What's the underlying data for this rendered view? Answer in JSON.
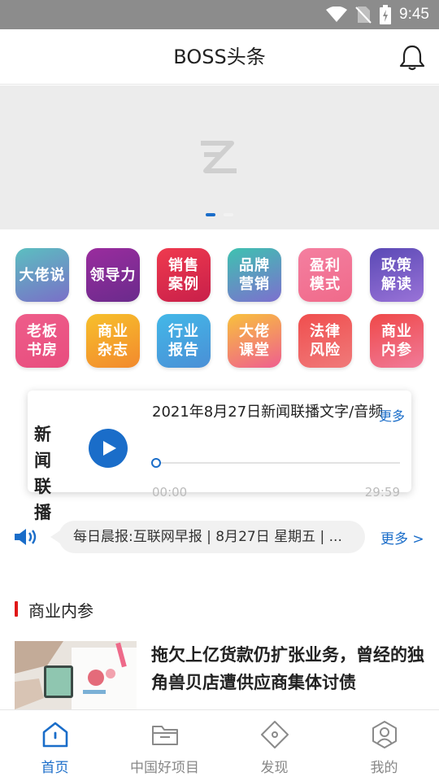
{
  "status": {
    "time": "9:45"
  },
  "header": {
    "title": "BOSS头条"
  },
  "banner": {
    "pages": 2,
    "active_page": 1
  },
  "categories": [
    {
      "label": "大佬说",
      "icon": "dalaoshuo",
      "colors": [
        "#5bbfc0",
        "#7a6fc8"
      ]
    },
    {
      "label": "领导力",
      "icon": "lingdaoli",
      "colors": [
        "#9a2c9e",
        "#6a2b8c"
      ]
    },
    {
      "label": "销售\n案例",
      "icon": "xiaoshou",
      "colors": [
        "#ef3a4e",
        "#c81f4a"
      ]
    },
    {
      "label": "品牌\n营销",
      "icon": "pinpai",
      "colors": [
        "#3ec2b0",
        "#7d6fcf"
      ]
    },
    {
      "label": "盈利\n模式",
      "icon": "yingli",
      "colors": [
        "#f47fa0",
        "#f06a8a"
      ]
    },
    {
      "label": "政策\n解读",
      "icon": "zhengce",
      "colors": [
        "#5a49b5",
        "#9a73d8"
      ]
    },
    {
      "label": "老板\n书房",
      "icon": "laoban",
      "colors": [
        "#ee5d8a",
        "#e84d7e"
      ]
    },
    {
      "label": "商业\n杂志",
      "icon": "zazhi",
      "colors": [
        "#f7c02c",
        "#f2892d"
      ]
    },
    {
      "label": "行业\n报告",
      "icon": "baogao",
      "colors": [
        "#43b8e8",
        "#4a8fd6"
      ]
    },
    {
      "label": "大佬\n课堂",
      "icon": "ketang",
      "colors": [
        "#f8c13c",
        "#ef5e8f"
      ]
    },
    {
      "label": "法律\n风险",
      "icon": "falv",
      "colors": [
        "#f04e4e",
        "#f07a7a"
      ]
    },
    {
      "label": "商业\n内参",
      "icon": "neican",
      "colors": [
        "#ef4848",
        "#f17b9a"
      ]
    }
  ],
  "news_player": {
    "label": "新 闻\n联 播",
    "title": "2021年8月27日新闻联播文字/音频",
    "more": "更多",
    "current_time": "00:00",
    "duration": "29:59",
    "progress": 0.0,
    "accent_color": "#1a6dc9"
  },
  "ticker": {
    "text": "每日晨报:互联网早报 | 8月27日 星期五 | ...",
    "more": "更多 >",
    "icon": "speaker-icon"
  },
  "section": {
    "title": "商业内参",
    "accent_color": "#e01818"
  },
  "article": {
    "title": "拖欠上亿货款仍扩张业务，曾经的独角兽贝店遭供应商集体讨债"
  },
  "tabs": [
    {
      "label": "首页",
      "icon": "home-icon",
      "active": true
    },
    {
      "label": "中国好项目",
      "icon": "folder-icon",
      "active": false
    },
    {
      "label": "发现",
      "icon": "discover-icon",
      "active": false
    },
    {
      "label": "我的",
      "icon": "profile-icon",
      "active": false
    }
  ]
}
